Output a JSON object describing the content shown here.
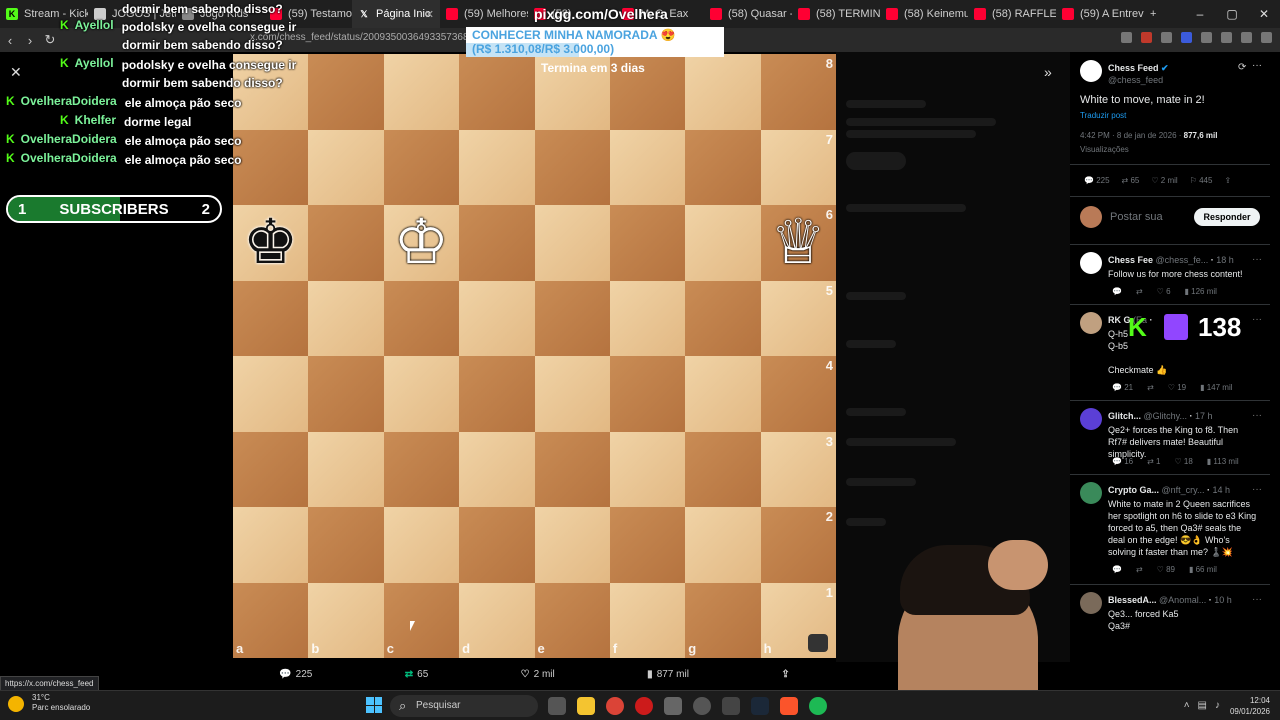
{
  "tabs": [
    {
      "label": "Stream - Kick D",
      "icon_color": "#53fc18",
      "icon": "kick-icon"
    },
    {
      "label": "JOGOS | Jetui",
      "icon_color": "#cccccc",
      "icon": "page-icon"
    },
    {
      "label": "Jogo Kids",
      "icon_color": "#888888",
      "icon": "page-icon"
    },
    {
      "label": "(59) Testamos c",
      "icon_color": "#ff0033",
      "icon": "youtube-icon"
    },
    {
      "label": "Página Inic",
      "icon_color": "#ffffff",
      "icon": "x-icon",
      "active": true
    },
    {
      "label": "(59) Melhores F",
      "icon_color": "#ff0033",
      "icon": "youtube-icon"
    },
    {
      "label": "(58) ...",
      "icon_color": "#ff0033",
      "icon": "youtube-icon"
    },
    {
      "label": "M. C. Eax",
      "icon_color": "#ff0033",
      "icon": "youtube-icon"
    },
    {
      "label": "(58) Quasar - I",
      "icon_color": "#ff0033",
      "icon": "youtube-icon"
    },
    {
      "label": "(58) TERMINAI",
      "icon_color": "#ff0033",
      "icon": "youtube-icon"
    },
    {
      "label": "(58) Keinemusi",
      "icon_color": "#ff0033",
      "icon": "youtube-icon"
    },
    {
      "label": "(58) RAFFLES D",
      "icon_color": "#ff0033",
      "icon": "youtube-icon"
    },
    {
      "label": "(59) A Entrevist",
      "icon_color": "#ff0033",
      "icon": "youtube-icon"
    }
  ],
  "new_tab_label": "+",
  "url": "x.com/chess_feed/status/2009350036493357368/pho",
  "status_url": "https://x.com/chess_feed",
  "board": {
    "ranks": [
      "8",
      "7",
      "6",
      "5",
      "4",
      "3",
      "2",
      "1"
    ],
    "files": [
      "a",
      "b",
      "c",
      "d",
      "e",
      "f",
      "g",
      "h"
    ],
    "pieces": [
      {
        "square": "a6",
        "piece": "black-king",
        "glyph": "♚"
      },
      {
        "square": "c6",
        "piece": "white-king",
        "glyph": "♔"
      },
      {
        "square": "h6",
        "piece": "white-queen",
        "glyph": "♕"
      }
    ]
  },
  "photo_actions": {
    "replies": "225",
    "reposts": "65",
    "likes": "2 mil",
    "views": "877 mil"
  },
  "stream_overlay": {
    "pix_text": "pixgg.com/Ovelhera",
    "goal_title": "CONHECER MINHA NAMORADA 😍",
    "goal_amount": "(R$ 1.310,08/R$ 3.000,00)",
    "goal_progress": 0.437,
    "goal_ends": "Termina em 3 dias",
    "subs_left": "1",
    "subs_label": "SUBSCRIBERS",
    "subs_right": "2",
    "viewer_count": "138"
  },
  "chat": [
    {
      "user": "",
      "msg": "dormir bem sabendo disso?",
      "kick": false
    },
    {
      "user": "Ayellol",
      "msg": "podolsky e ovelha consegue ir",
      "kick": true
    },
    {
      "user": "",
      "msg": "dormir bem sabendo disso?",
      "kick": false
    },
    {
      "user": "Ayellol",
      "msg": "podolsky e ovelha consegue ir",
      "kick": true
    },
    {
      "user": "",
      "msg": "dormir bem sabendo disso?",
      "kick": false
    },
    {
      "user": "OvelheraDoidera",
      "msg": "ele almoça pão seco",
      "kick": true
    },
    {
      "user": "Khelfer",
      "msg": "dorme legal",
      "kick": true
    },
    {
      "user": "OvelheraDoidera",
      "msg": "ele almoça pão seco",
      "kick": true
    },
    {
      "user": "OvelheraDoidera",
      "msg": "ele almoça pão seco",
      "kick": true
    }
  ],
  "tweet": {
    "name": "Chess Feed",
    "handle": "@chess_feed",
    "text": "White to move, mate in 2!",
    "translate": "Traduzir post",
    "time": "4:42 PM · 8 de jan de 2026 · ",
    "views_count": "877,6 mil",
    "views_label": "Visualizações",
    "replies": "225",
    "reposts": "65",
    "likes": "2 mil",
    "bookmarks": "445",
    "reply_placeholder": "Postar sua",
    "reply_button": "Responder"
  },
  "replies": [
    {
      "name": "Chess Fee",
      "handle": "@chess_fe...",
      "time": "18 h",
      "text": "Follow us for more chess content!",
      "stats": [
        "",
        "",
        "6",
        "126 mil"
      ]
    },
    {
      "name": "RK G",
      "handle": "(Ea",
      "time": "",
      "text": "Q-h5\nQ-b5\n\nCheckmate 👍",
      "stats": [
        "21",
        "",
        "19",
        "147 mil"
      ]
    },
    {
      "name": "Glitch...",
      "handle": "@Glitchy...",
      "time": "17 h",
      "text": "Qe2+ forces the King to f8. Then Rf7# delivers mate! Beautiful simplicity.",
      "stats": [
        "16",
        "1",
        "18",
        "113 mil"
      ]
    },
    {
      "name": "Crypto Ga...",
      "handle": "@nft_cry...",
      "time": "14 h",
      "text": "White to mate in 2 Queen sacrifices her spotlight on h6 to slide to e3 King forced to a5, then Qa3# seals the deal on the edge! 😎👌 Who's solving it faster than me? ♟️💥",
      "stats": [
        "",
        "",
        "89",
        "66 mil"
      ]
    },
    {
      "name": "BlessedA...",
      "handle": "@Anomal...",
      "time": "10 h",
      "text": "Qe3... forced Ka5\nQa3#",
      "stats": []
    }
  ],
  "taskbar": {
    "temp": "31°C",
    "weather": "Parc ensolarado",
    "search_placeholder": "Pesquisar",
    "time": "12:04",
    "date": "09/01/2026"
  }
}
